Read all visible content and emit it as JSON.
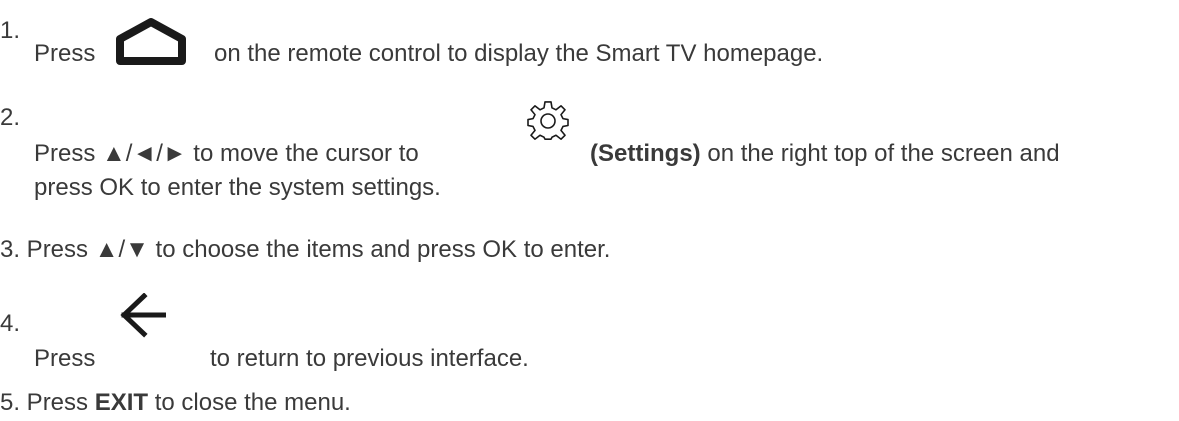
{
  "steps": [
    {
      "number": "1.",
      "before_icon": "Press",
      "icon": "home-icon",
      "after_icon": "on the remote control to display the Smart TV homepage."
    },
    {
      "number": "2.",
      "before_icon": "Press ▲/◄/► to move the cursor to",
      "icon": "gear-icon",
      "bold_text": "(Settings)",
      "after_bold": "on the right top of the screen and",
      "line2": "press OK to enter the system settings."
    },
    {
      "text": "3. Press ▲/▼ to choose the items and press OK to enter."
    },
    {
      "number": "4.",
      "before_icon": "Press",
      "icon": "back-arrow-icon",
      "after_icon": "to return to previous interface."
    },
    {
      "prefix": "5. Press",
      "bold_text": "EXIT",
      "suffix": "to close the menu."
    }
  ],
  "colors": {
    "text": "#3a3a3a",
    "icon": "#1a1a1a"
  }
}
